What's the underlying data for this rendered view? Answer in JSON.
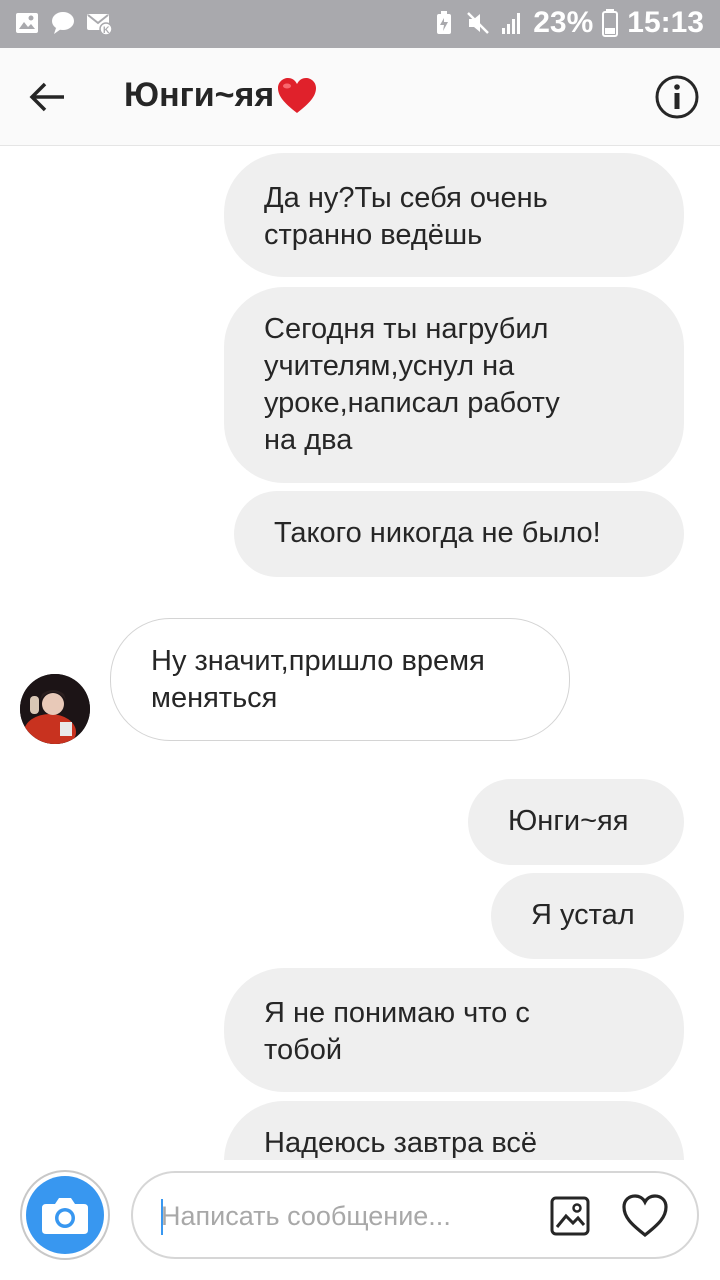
{
  "status_bar": {
    "battery": "23%",
    "time": "15:13"
  },
  "header": {
    "title": "Юнги~яя"
  },
  "messages": [
    {
      "dir": "out",
      "lines": [
        "Да ну?Ты себя очень",
        "странно ведёшь"
      ]
    },
    {
      "dir": "out",
      "lines": [
        "Сегодня ты нагрубил",
        "учителям,уснул на",
        "уроке,написал работу",
        "на два"
      ]
    },
    {
      "dir": "out",
      "lines": [
        "Такого никогда не было!"
      ]
    },
    {
      "dir": "in",
      "lines": [
        "Ну значит,пришло время",
        "меняться"
      ]
    },
    {
      "dir": "out",
      "lines": [
        "Юнги~яя"
      ]
    },
    {
      "dir": "out",
      "lines": [
        "Я устал"
      ]
    },
    {
      "dir": "out",
      "lines": [
        "Я не понимаю что с",
        "тобой"
      ]
    },
    {
      "dir": "out",
      "lines": [
        "Надеюсь завтра всё"
      ]
    }
  ],
  "composer": {
    "placeholder": "Написать сообщение..."
  },
  "colors": {
    "status_bar": "#a9a9ad",
    "outgoing_bubble": "#efefef",
    "camera_button": "#3897f0",
    "heart": "#e0212b"
  }
}
